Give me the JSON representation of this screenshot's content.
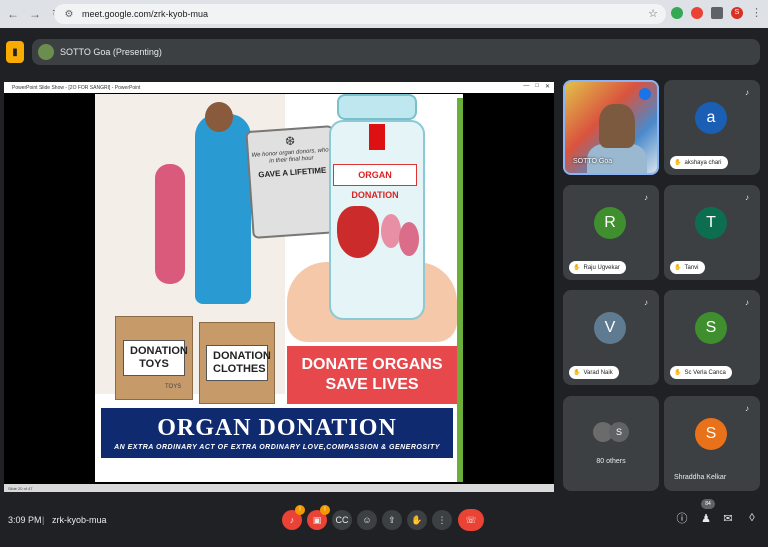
{
  "browser": {
    "url": "meet.google.com/zrk-kyob-mua",
    "profile_initial": "S"
  },
  "presenting": {
    "label": "SOTTO Goa (Presenting)"
  },
  "powerpoint": {
    "title": "PowerPoint Slide Show - [2O FOR SANGRI] - PowerPoint",
    "status": "Slide 20 of 47"
  },
  "slide": {
    "quote_text": "We honor organ donors, who, in their final hour",
    "quote_sub": "GAVE A LIFETIME",
    "jar_label": "ORGAN DONATION",
    "box1_label": "DONATION TOYS",
    "box2_label": "DONATION CLOTHES",
    "box1_tag": "TOYS",
    "donate_text": "DONATE ORGANS SAVE LIVES",
    "banner_title": "ORGAN DONATION",
    "banner_sub": "AN EXTRA ORDINARY ACT OF EXTRA ORDINARY LOVE,COMPASSION & GENEROSITY"
  },
  "participants": [
    {
      "name": "SOTTO Goa",
      "type": "video"
    },
    {
      "name": "akshaya chari",
      "initial": "a",
      "color": "#1a5fb4"
    },
    {
      "name": "Raju Ugvekar",
      "initial": "R",
      "color": "#3f8f2f"
    },
    {
      "name": "Tanvi",
      "initial": "T",
      "color": "#0d6e4f"
    },
    {
      "name": "Varad Naik",
      "initial": "V",
      "color": "#5f7b91"
    },
    {
      "name": "Sc Verla Canca",
      "initial": "S",
      "color": "#3f8f2f"
    },
    {
      "name": "80 others",
      "initial": "S"
    },
    {
      "name": "Shraddha Kelkar",
      "initial": "S",
      "color": "#e8711a"
    }
  ],
  "bottom": {
    "time": "3:09 PM",
    "separator": "|",
    "meeting_code": "zrk-kyob-mua",
    "participant_count": "84",
    "mic_badge": "!",
    "cam_badge": "!"
  },
  "colors": {
    "accent": "#1a73e8",
    "end_call": "#ea4335",
    "app_badge": "#f9ab00"
  }
}
